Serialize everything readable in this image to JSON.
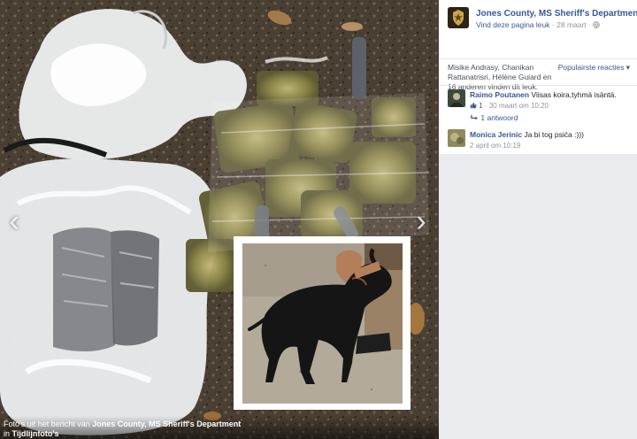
{
  "photo": {
    "caption_prefix": "Foto's uit het bericht van",
    "caption_page": "Jones County, MS Sheriff's Department",
    "caption_in": "in",
    "caption_album": "Tijdlijnfoto's",
    "prev_arrow": "‹",
    "next_arrow": "›"
  },
  "sidebar": {
    "page_name": "Jones County, MS Sheriff's Department",
    "like_page": "Vind deze pagina leuk",
    "date": "28 maart",
    "separator_dot": "·",
    "privacy_icon": "globe-icon",
    "likes_text": "Misike Andrasy, Chanikan Rattanatrisri, Hélène Guiard en 16 anderen vinden dit leuk.",
    "sort_label": "Populairste reacties",
    "sort_caret": "▾",
    "comments": [
      {
        "author": "Raimo Poutanen",
        "text": "Viisas koira,tyhmä isäntä.",
        "like_icon": "thumbs-up-icon",
        "like_count": "1",
        "timestamp": "30 maart om 10:20",
        "replies": "1 antwoord"
      },
      {
        "author": "Monica Jerinic",
        "text": "Ja bi tog psića :)))",
        "timestamp": "2 april om 10:19"
      }
    ]
  }
}
